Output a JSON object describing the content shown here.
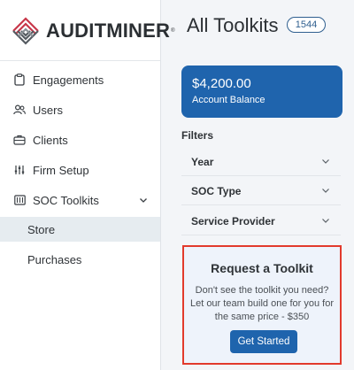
{
  "brand": {
    "name": "AUDITMINER",
    "mark": "®"
  },
  "sidebar": {
    "items": [
      {
        "label": "Engagements",
        "icon": "clipboard-icon"
      },
      {
        "label": "Users",
        "icon": "users-icon"
      },
      {
        "label": "Clients",
        "icon": "briefcase-icon"
      },
      {
        "label": "Firm Setup",
        "icon": "sliders-icon"
      },
      {
        "label": "SOC Toolkits",
        "icon": "toolkit-icon",
        "expanded": true
      }
    ],
    "subitems": [
      {
        "label": "Store",
        "active": true
      },
      {
        "label": "Purchases",
        "active": false
      }
    ]
  },
  "main": {
    "title": "All Toolkits",
    "count": "1544",
    "balance": {
      "amount": "$4,200.00",
      "label": "Account Balance"
    },
    "filters": {
      "title": "Filters",
      "rows": [
        {
          "label": "Year"
        },
        {
          "label": "SOC Type"
        },
        {
          "label": "Service Provider"
        }
      ]
    },
    "request": {
      "title": "Request a Toolkit",
      "description": "Don't see the toolkit you need? Let our team build one for you for the same price - $350",
      "button_label": "Get Started"
    }
  },
  "colors": {
    "accent": "#1f64ad",
    "highlight_border": "#e23a2c",
    "active_nav_bg": "#e6ecf0",
    "brand_red": "#c8374a"
  }
}
